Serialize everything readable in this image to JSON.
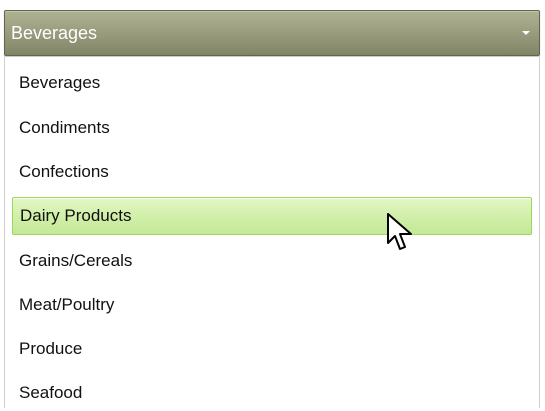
{
  "combo": {
    "selected_value": "Beverages",
    "arrow_icon": "chevron-down-icon"
  },
  "list": {
    "items": [
      {
        "label": "Beverages"
      },
      {
        "label": "Condiments"
      },
      {
        "label": "Confections"
      },
      {
        "label": "Dairy Products",
        "state": "hovered"
      },
      {
        "label": "Grains/Cereals"
      },
      {
        "label": "Meat/Poultry"
      },
      {
        "label": "Produce"
      },
      {
        "label": "Seafood"
      }
    ]
  },
  "theme": {
    "header_color": "#9c9e80",
    "hover_color": "#d3f0ac",
    "hover_border_color": "#9fd65f",
    "text_color": "#111111"
  },
  "pointer": {
    "icon": "mouse-pointer-icon"
  }
}
